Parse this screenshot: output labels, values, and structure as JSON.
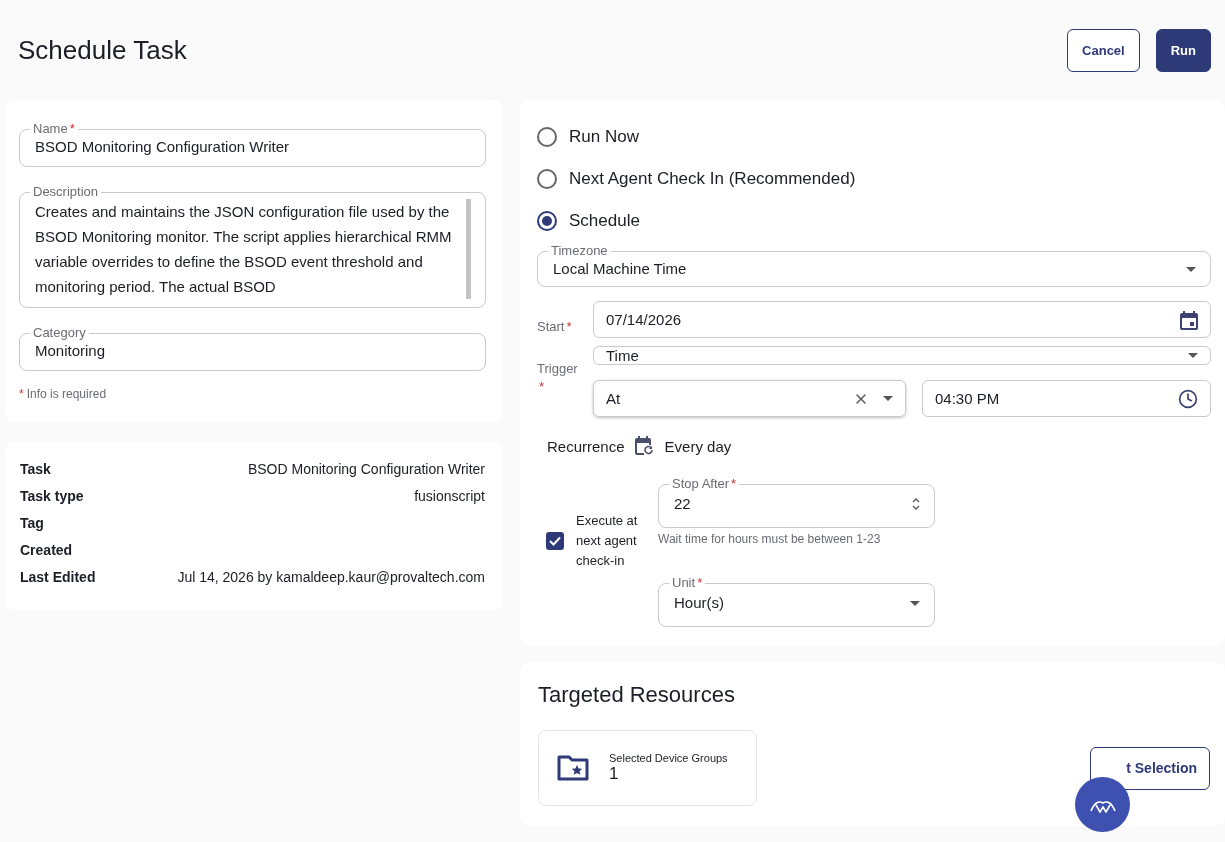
{
  "header": {
    "title": "Schedule Task",
    "buttons": [
      {
        "label": "Cancel",
        "kind": "outline"
      },
      {
        "label": "Run",
        "kind": "primary"
      }
    ]
  },
  "details_form": {
    "fields": [
      {
        "label": "Name",
        "required_mark": "*",
        "value": "BSOD Monitoring Configuration Writer",
        "kind": "input"
      },
      {
        "label": "Description",
        "value": "Creates and maintains the JSON configuration file used by the BSOD Monitoring monitor. The script applies hierarchical RMM variable overrides to define the BSOD event threshold and monitoring period. The actual BSOD",
        "kind": "textarea"
      },
      {
        "label": "Category",
        "value": "Monitoring",
        "kind": "input"
      }
    ],
    "required_note": {
      "mark": "*",
      "text": "Info is required"
    }
  },
  "summary": {
    "rows": [
      {
        "label": "Task",
        "value": "BSOD Monitoring Configuration Writer"
      },
      {
        "label": "Task type",
        "value": "fusionscript"
      },
      {
        "label": "Tag"
      },
      {
        "label": "Created"
      },
      {
        "label": "Last Edited",
        "value": "Jul 14, 2026 by kamaldeep.kaur@provaltech.com"
      }
    ]
  },
  "schedule": {
    "options": [
      {
        "label": "Run Now",
        "selected": false
      },
      {
        "label": "Next Agent Check In (Recommended)",
        "selected": false
      },
      {
        "label": "Schedule",
        "selected": true
      }
    ],
    "timezone": {
      "label": "Timezone",
      "value": "Local Machine Time"
    },
    "start": {
      "label": "Start",
      "required_mark": "*",
      "value": "07/14/2026"
    },
    "trigger": {
      "label": "Trigger",
      "required_mark": "*",
      "value": "Time"
    },
    "trigger_mode": {
      "value": "At"
    },
    "time": {
      "value": "04:30 PM"
    },
    "recurrence": {
      "label": "Recurrence",
      "value": "Every day"
    },
    "execute_next": {
      "label": "Execute at next agent check-in",
      "checked": true
    },
    "stop_after": {
      "label": "Stop After",
      "required_mark": "*",
      "value": "22",
      "helper": "Wait time for hours must be between 1-23"
    },
    "unit": {
      "label": "Unit",
      "required_mark": "*",
      "value": "Hour(s)"
    }
  },
  "targeted": {
    "title": "Targeted Resources",
    "groups": [
      {
        "label": "Selected Device Groups",
        "count": "1"
      }
    ],
    "edit_button": {
      "label": "t Selection"
    }
  }
}
